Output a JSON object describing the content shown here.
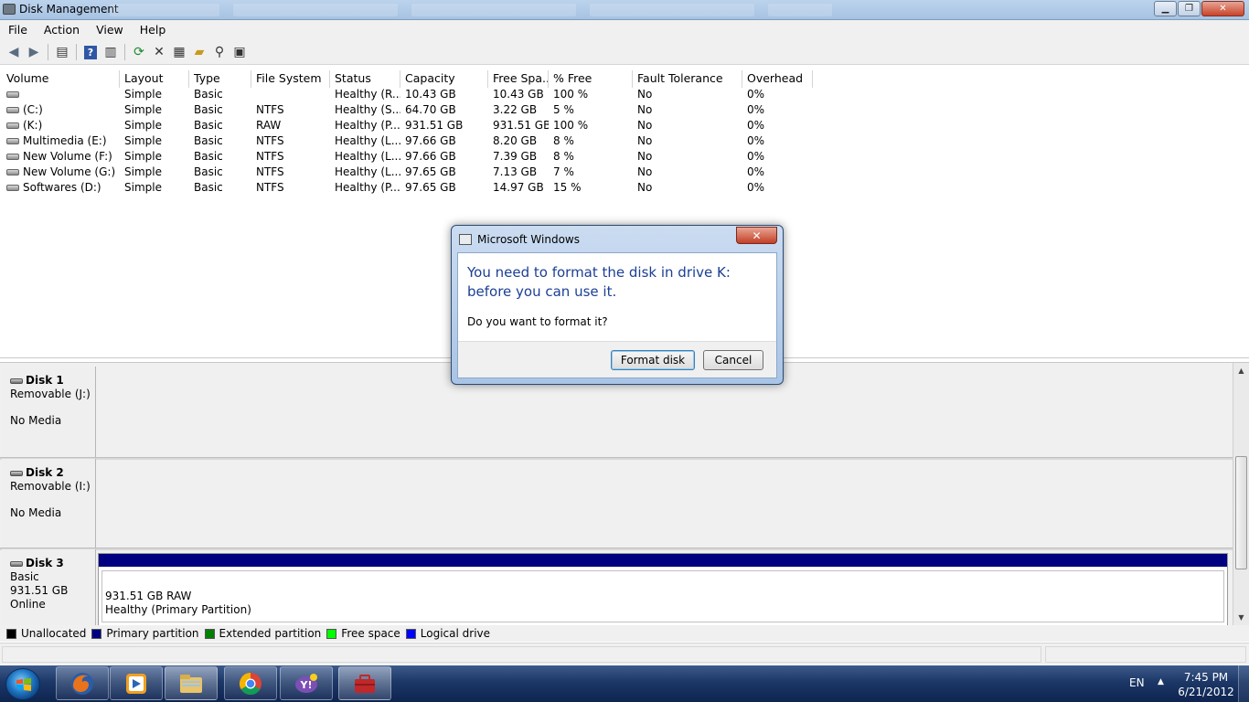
{
  "window": {
    "title": "Disk Management"
  },
  "menu": [
    "File",
    "Action",
    "View",
    "Help"
  ],
  "toolbar_icons": [
    "back-icon",
    "forward-icon",
    "properties-view-icon",
    "help-icon",
    "panel-icon",
    "refresh-icon",
    "delete-icon",
    "properties-icon",
    "open-icon",
    "explore-icon",
    "rescan-icon"
  ],
  "volume_table": {
    "columns": [
      "Volume",
      "Layout",
      "Type",
      "File System",
      "Status",
      "Capacity",
      "Free Spa...",
      "% Free",
      "Fault Tolerance",
      "Overhead"
    ],
    "rows": [
      [
        "",
        "Simple",
        "Basic",
        "",
        "Healthy (R...",
        "10.43 GB",
        "10.43 GB",
        "100 %",
        "No",
        "0%"
      ],
      [
        "(C:)",
        "Simple",
        "Basic",
        "NTFS",
        "Healthy (S...",
        "64.70 GB",
        "3.22 GB",
        "5 %",
        "No",
        "0%"
      ],
      [
        "(K:)",
        "Simple",
        "Basic",
        "RAW",
        "Healthy (P...",
        "931.51 GB",
        "931.51 GB",
        "100 %",
        "No",
        "0%"
      ],
      [
        "Multimedia (E:)",
        "Simple",
        "Basic",
        "NTFS",
        "Healthy (L...",
        "97.66 GB",
        "8.20 GB",
        "8 %",
        "No",
        "0%"
      ],
      [
        "New Volume (F:)",
        "Simple",
        "Basic",
        "NTFS",
        "Healthy (L...",
        "97.66 GB",
        "7.39 GB",
        "8 %",
        "No",
        "0%"
      ],
      [
        "New Volume (G:)",
        "Simple",
        "Basic",
        "NTFS",
        "Healthy (L...",
        "97.65 GB",
        "7.13 GB",
        "7 %",
        "No",
        "0%"
      ],
      [
        "Softwares (D:)",
        "Simple",
        "Basic",
        "NTFS",
        "Healthy (P...",
        "97.65 GB",
        "14.97 GB",
        "15 %",
        "No",
        "0%"
      ]
    ]
  },
  "disks": [
    {
      "name": "Disk 1",
      "line1": "Removable (J:)",
      "line2": "No Media"
    },
    {
      "name": "Disk 2",
      "line1": "Removable (I:)",
      "line2": "No Media"
    },
    {
      "name": "Disk 3",
      "line1": "Basic",
      "line2": "931.51 GB",
      "line3": "Online",
      "partition": {
        "size": "931.51 GB RAW",
        "status": "Healthy (Primary Partition)",
        "bar_color": "#000080"
      }
    }
  ],
  "legend": [
    {
      "label": "Unallocated",
      "color": "#000000"
    },
    {
      "label": "Primary partition",
      "color": "#000080"
    },
    {
      "label": "Extended partition",
      "color": "#008000"
    },
    {
      "label": "Free space",
      "color": "#00ff00"
    },
    {
      "label": "Logical drive",
      "color": "#0000ff"
    }
  ],
  "dialog": {
    "title": "Microsoft Windows",
    "message": "You need to format the disk in drive K: before you can use it.",
    "question": "Do you want to format it?",
    "primary_button": "Format disk",
    "secondary_button": "Cancel",
    "close_symbol": "✕"
  },
  "taskbar": {
    "apps": [
      "firefox-icon",
      "media-player-icon",
      "explorer-icon",
      "chrome-icon",
      "messenger-icon",
      "computer-management-icon"
    ],
    "language": "EN",
    "time": "7:45 PM",
    "date": "6/21/2012"
  }
}
